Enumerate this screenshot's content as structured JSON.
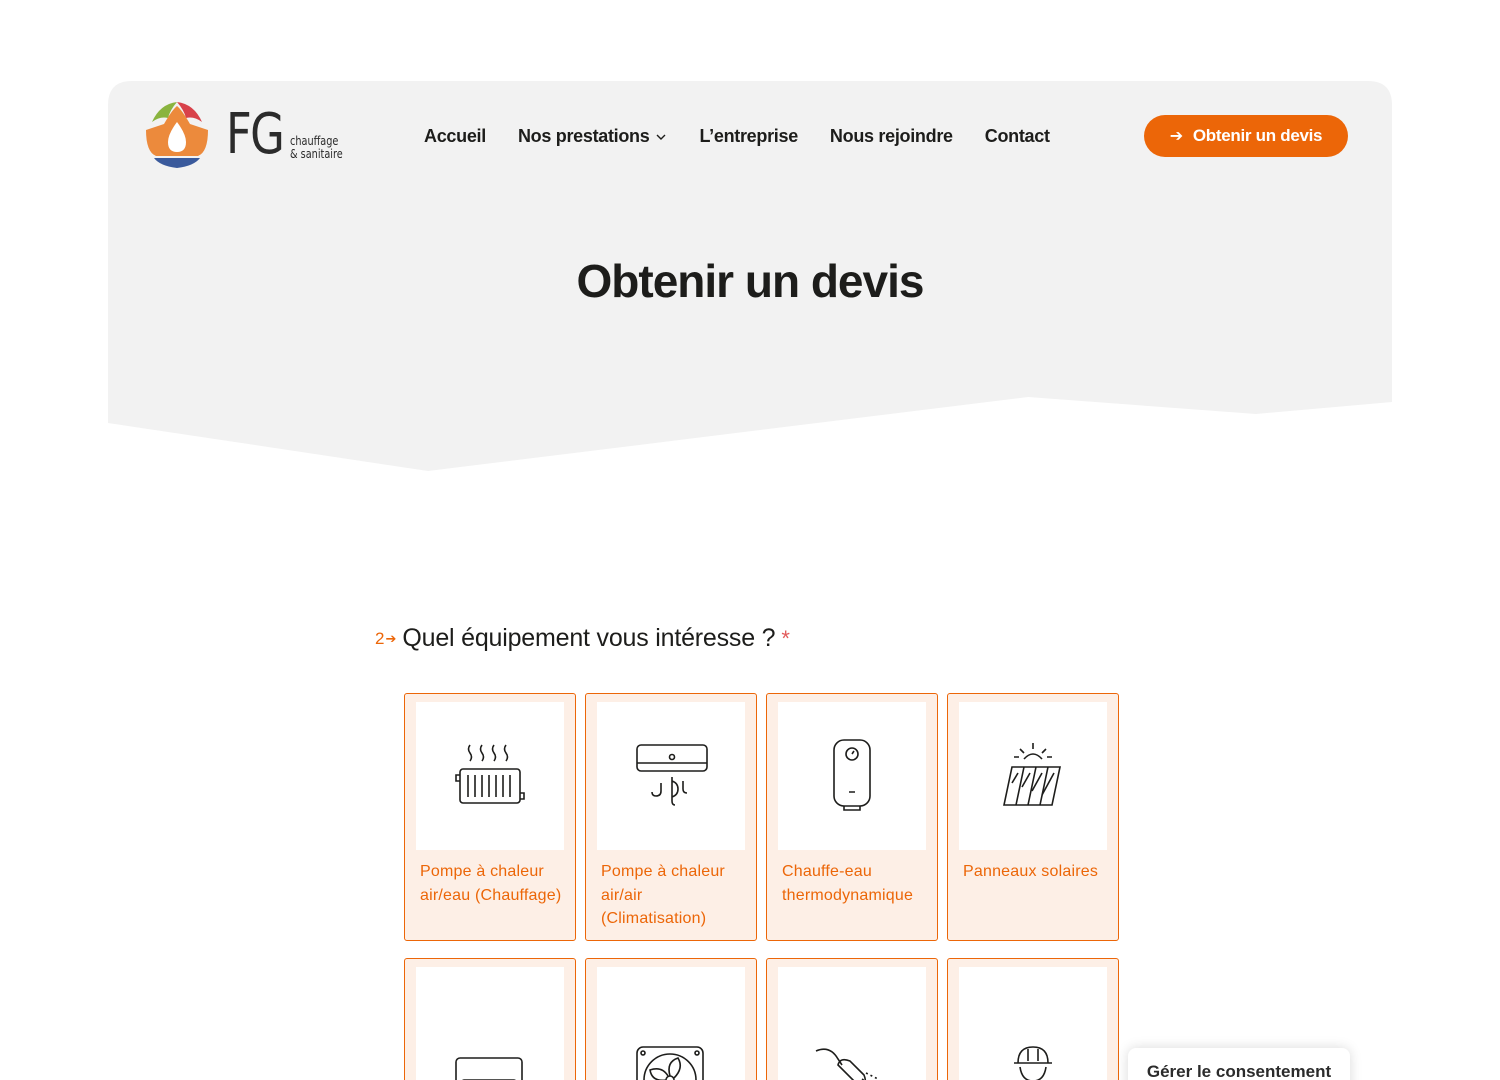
{
  "header": {
    "logo": {
      "brand": "FG",
      "tagline_line1": "chauffage",
      "tagline_line2": "& sanitaire"
    },
    "nav": [
      {
        "label": "Accueil",
        "has_dropdown": false
      },
      {
        "label": "Nos prestations",
        "has_dropdown": true
      },
      {
        "label": "L’entreprise",
        "has_dropdown": false
      },
      {
        "label": "Nous rejoindre",
        "has_dropdown": false
      },
      {
        "label": "Contact",
        "has_dropdown": false
      }
    ],
    "cta": {
      "label": "Obtenir un devis",
      "icon": "arrow-right-icon"
    }
  },
  "hero": {
    "title": "Obtenir un devis"
  },
  "form": {
    "step_number": "2",
    "question": "Quel équipement vous intéresse ?",
    "required_mark": "*",
    "options": [
      {
        "label": "Pompe à chaleur air/eau (Chauffage)",
        "icon": "radiator-icon"
      },
      {
        "label": "Pompe à chaleur air/air (Climatisation)",
        "icon": "air-conditioner-icon"
      },
      {
        "label": "Chauffe-eau thermodynamique",
        "icon": "water-heater-icon"
      },
      {
        "label": "Panneaux solaires",
        "icon": "solar-panel-icon"
      },
      {
        "label": "",
        "icon": "air-unit-icon"
      },
      {
        "label": "",
        "icon": "ventilation-fan-icon"
      },
      {
        "label": "",
        "icon": "shower-icon"
      },
      {
        "label": "",
        "icon": "plumber-worker-icon"
      }
    ]
  },
  "consent": {
    "label": "Gérer le consentement"
  },
  "colors": {
    "accent": "#ec6608",
    "hero_bg": "#f2f2f2",
    "card_bg": "#fdefe6",
    "text": "#1d1d1b"
  }
}
